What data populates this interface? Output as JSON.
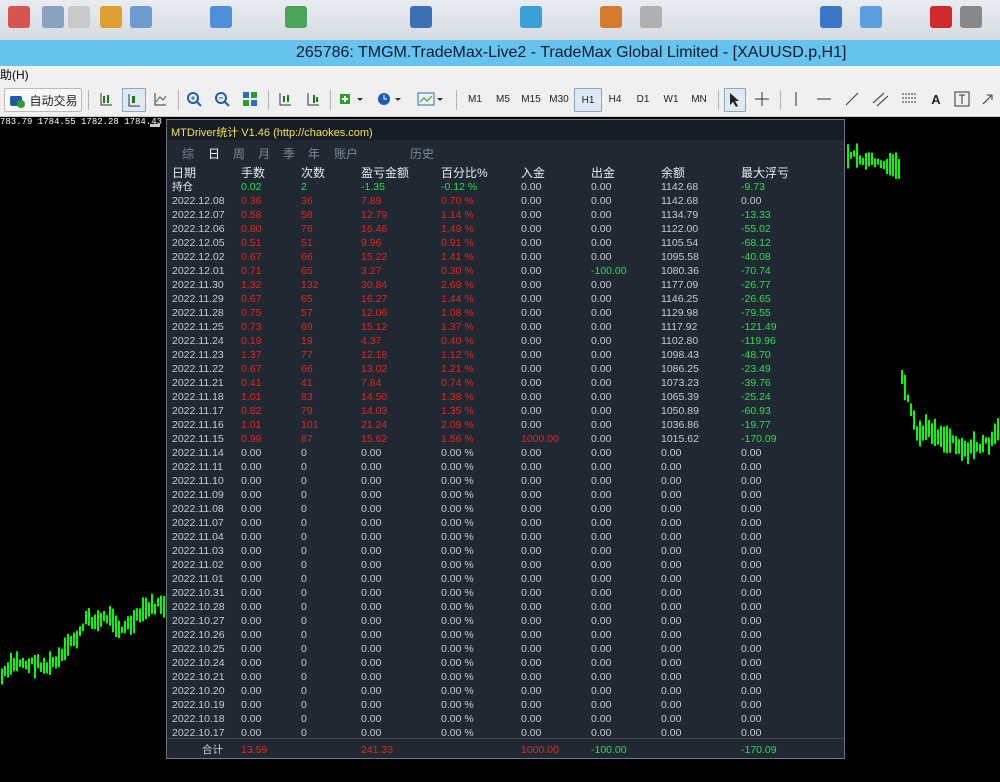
{
  "window": {
    "title": "265786: TMGM.TradeMax-Live2 - TradeMax Global Limited - [XAUUSD.p,H1]",
    "menu_help": "助(H)"
  },
  "toolbar": {
    "autotrade_label": "自动交易",
    "timeframes": [
      "M1",
      "M5",
      "M15",
      "M30",
      "H1",
      "H4",
      "D1",
      "W1",
      "MN"
    ],
    "active_timeframe": "H1"
  },
  "chart": {
    "ohlc_text": "783.79 1784.55 1782.28 1784.43",
    "candle_color": "#00ff00",
    "background": "#000000"
  },
  "panel": {
    "title": "MTDriver统计 V1.46  (http://chaokes.com)",
    "tabs": [
      "综",
      "日",
      "周",
      "月",
      "季",
      "年",
      "账户",
      "历史"
    ],
    "active_tab": "日",
    "headers": [
      "日期",
      "手数",
      "次数",
      "盈亏金额",
      "百分比%",
      "入金",
      "出金",
      "余额",
      "最大浮亏"
    ],
    "holding": [
      "持仓",
      "0.02",
      "2",
      "-1.35",
      "-0.12 %",
      "0.00",
      "0.00",
      "1142.68",
      "-9.73"
    ],
    "rows": [
      [
        "2022.12.08",
        "0.36",
        "36",
        "7.89",
        "0.70 %",
        "0.00",
        "0.00",
        "1142.68",
        "0.00"
      ],
      [
        "2022.12.07",
        "0.58",
        "58",
        "12.79",
        "1.14 %",
        "0.00",
        "0.00",
        "1134.79",
        "-13.33"
      ],
      [
        "2022.12.06",
        "0.80",
        "76",
        "16.46",
        "1.49 %",
        "0.00",
        "0.00",
        "1122.00",
        "-55.02"
      ],
      [
        "2022.12.05",
        "0.51",
        "51",
        "9.96",
        "0.91 %",
        "0.00",
        "0.00",
        "1105.54",
        "-68.12"
      ],
      [
        "2022.12.02",
        "0.67",
        "66",
        "15.22",
        "1.41 %",
        "0.00",
        "0.00",
        "1095.58",
        "-40.08"
      ],
      [
        "2022.12.01",
        "0.71",
        "65",
        "3.27",
        "0.30 %",
        "0.00",
        "-100.00",
        "1080.36",
        "-70.74"
      ],
      [
        "2022.11.30",
        "1.32",
        "132",
        "30.84",
        "2.69 %",
        "0.00",
        "0.00",
        "1177.09",
        "-26.77"
      ],
      [
        "2022.11.29",
        "0.67",
        "65",
        "16.27",
        "1.44 %",
        "0.00",
        "0.00",
        "1146.25",
        "-26.65"
      ],
      [
        "2022.11.28",
        "0.75",
        "57",
        "12.06",
        "1.08 %",
        "0.00",
        "0.00",
        "1129.98",
        "-79.55"
      ],
      [
        "2022.11.25",
        "0.73",
        "69",
        "15.12",
        "1.37 %",
        "0.00",
        "0.00",
        "1117.92",
        "-121.49"
      ],
      [
        "2022.11.24",
        "0.19",
        "19",
        "4.37",
        "0.40 %",
        "0.00",
        "0.00",
        "1102.80",
        "-119.96"
      ],
      [
        "2022.11.23",
        "1.37",
        "77",
        "12.18",
        "1.12 %",
        "0.00",
        "0.00",
        "1098.43",
        "-48.70"
      ],
      [
        "2022.11.22",
        "0.67",
        "66",
        "13.02",
        "1.21 %",
        "0.00",
        "0.00",
        "1086.25",
        "-23.49"
      ],
      [
        "2022.11.21",
        "0.41",
        "41",
        "7.84",
        "0.74 %",
        "0.00",
        "0.00",
        "1073.23",
        "-39.76"
      ],
      [
        "2022.11.18",
        "1.01",
        "83",
        "14.50",
        "1.38 %",
        "0.00",
        "0.00",
        "1065.39",
        "-25.24"
      ],
      [
        "2022.11.17",
        "0.82",
        "79",
        "14.03",
        "1.35 %",
        "0.00",
        "0.00",
        "1050.89",
        "-60.93"
      ],
      [
        "2022.11.16",
        "1.01",
        "101",
        "21.24",
        "2.09 %",
        "0.00",
        "0.00",
        "1036.86",
        "-19.77"
      ],
      [
        "2022.11.15",
        "0.99",
        "87",
        "15.62",
        "1.56 %",
        "1000.00",
        "0.00",
        "1015.62",
        "-170.09"
      ],
      [
        "2022.11.14",
        "0.00",
        "0",
        "0.00",
        "0.00 %",
        "0.00",
        "0.00",
        "0.00",
        "0.00"
      ],
      [
        "2022.11.11",
        "0.00",
        "0",
        "0.00",
        "0.00 %",
        "0.00",
        "0.00",
        "0.00",
        "0.00"
      ],
      [
        "2022.11.10",
        "0.00",
        "0",
        "0.00",
        "0.00 %",
        "0.00",
        "0.00",
        "0.00",
        "0.00"
      ],
      [
        "2022.11.09",
        "0.00",
        "0",
        "0.00",
        "0.00 %",
        "0.00",
        "0.00",
        "0.00",
        "0.00"
      ],
      [
        "2022.11.08",
        "0.00",
        "0",
        "0.00",
        "0.00 %",
        "0.00",
        "0.00",
        "0.00",
        "0.00"
      ],
      [
        "2022.11.07",
        "0.00",
        "0",
        "0.00",
        "0.00 %",
        "0.00",
        "0.00",
        "0.00",
        "0.00"
      ],
      [
        "2022.11.04",
        "0.00",
        "0",
        "0.00",
        "0.00 %",
        "0.00",
        "0.00",
        "0.00",
        "0.00"
      ],
      [
        "2022.11.03",
        "0.00",
        "0",
        "0.00",
        "0.00 %",
        "0.00",
        "0.00",
        "0.00",
        "0.00"
      ],
      [
        "2022.11.02",
        "0.00",
        "0",
        "0.00",
        "0.00 %",
        "0.00",
        "0.00",
        "0.00",
        "0.00"
      ],
      [
        "2022.11.01",
        "0.00",
        "0",
        "0.00",
        "0.00 %",
        "0.00",
        "0.00",
        "0.00",
        "0.00"
      ],
      [
        "2022.10.31",
        "0.00",
        "0",
        "0.00",
        "0.00 %",
        "0.00",
        "0.00",
        "0.00",
        "0.00"
      ],
      [
        "2022.10.28",
        "0.00",
        "0",
        "0.00",
        "0.00 %",
        "0.00",
        "0.00",
        "0.00",
        "0.00"
      ],
      [
        "2022.10.27",
        "0.00",
        "0",
        "0.00",
        "0.00 %",
        "0.00",
        "0.00",
        "0.00",
        "0.00"
      ],
      [
        "2022.10.26",
        "0.00",
        "0",
        "0.00",
        "0.00 %",
        "0.00",
        "0.00",
        "0.00",
        "0.00"
      ],
      [
        "2022.10.25",
        "0.00",
        "0",
        "0.00",
        "0.00 %",
        "0.00",
        "0.00",
        "0.00",
        "0.00"
      ],
      [
        "2022.10.24",
        "0.00",
        "0",
        "0.00",
        "0.00 %",
        "0.00",
        "0.00",
        "0.00",
        "0.00"
      ],
      [
        "2022.10.21",
        "0.00",
        "0",
        "0.00",
        "0.00 %",
        "0.00",
        "0.00",
        "0.00",
        "0.00"
      ],
      [
        "2022.10.20",
        "0.00",
        "0",
        "0.00",
        "0.00 %",
        "0.00",
        "0.00",
        "0.00",
        "0.00"
      ],
      [
        "2022.10.19",
        "0.00",
        "0",
        "0.00",
        "0.00 %",
        "0.00",
        "0.00",
        "0.00",
        "0.00"
      ],
      [
        "2022.10.18",
        "0.00",
        "0",
        "0.00",
        "0.00 %",
        "0.00",
        "0.00",
        "0.00",
        "0.00"
      ],
      [
        "2022.10.17",
        "0.00",
        "0",
        "0.00",
        "0.00 %",
        "0.00",
        "0.00",
        "0.00",
        "0.00"
      ]
    ],
    "totals": [
      "合计",
      "13.59",
      "",
      "241.33",
      "",
      "1000.00",
      "-100.00",
      "",
      "-170.09"
    ],
    "colors": {
      "profit": "#e0281f",
      "loss": "#29e04a",
      "title": "#f2e24a"
    }
  }
}
